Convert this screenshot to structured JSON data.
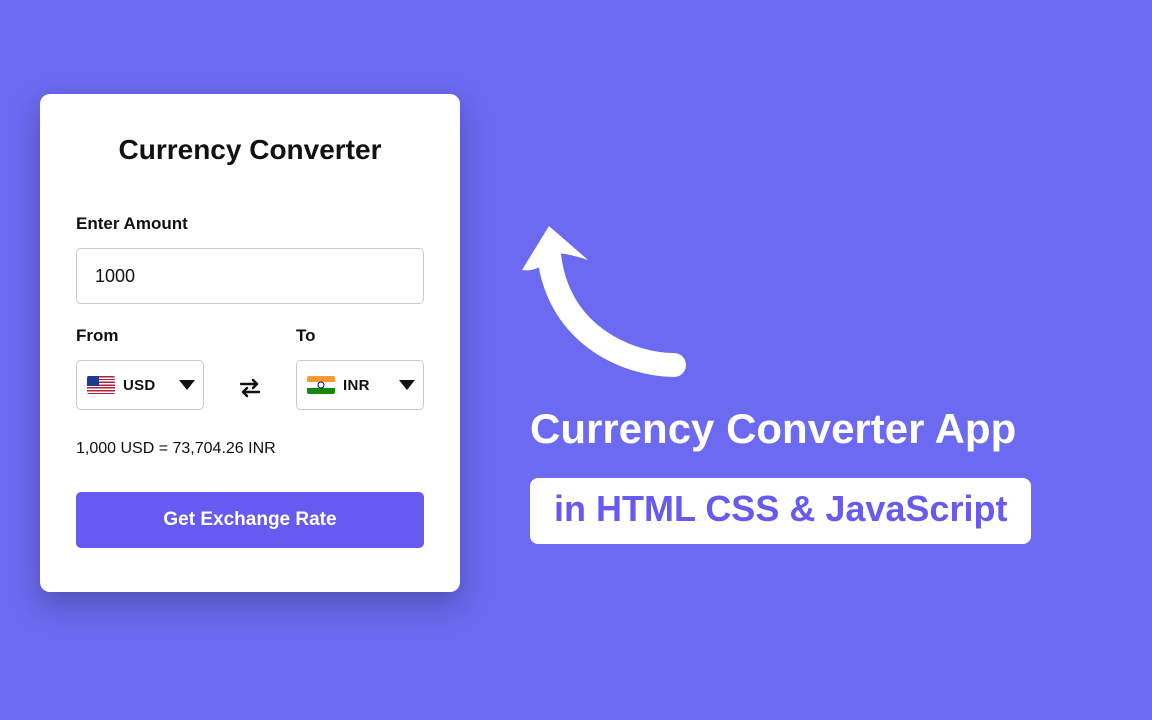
{
  "card": {
    "title": "Currency Converter",
    "amount_label": "Enter Amount",
    "amount_value": "1000",
    "from_label": "From",
    "to_label": "To",
    "from_currency": "USD",
    "to_currency": "INR",
    "result_text": "1,000 USD = 73,704.26 INR",
    "button_label": "Get Exchange Rate"
  },
  "banner": {
    "title": "Currency Converter App",
    "subtitle": "in HTML CSS & JavaScript"
  },
  "colors": {
    "bg": "#6b6af1",
    "accent": "#675af0"
  }
}
